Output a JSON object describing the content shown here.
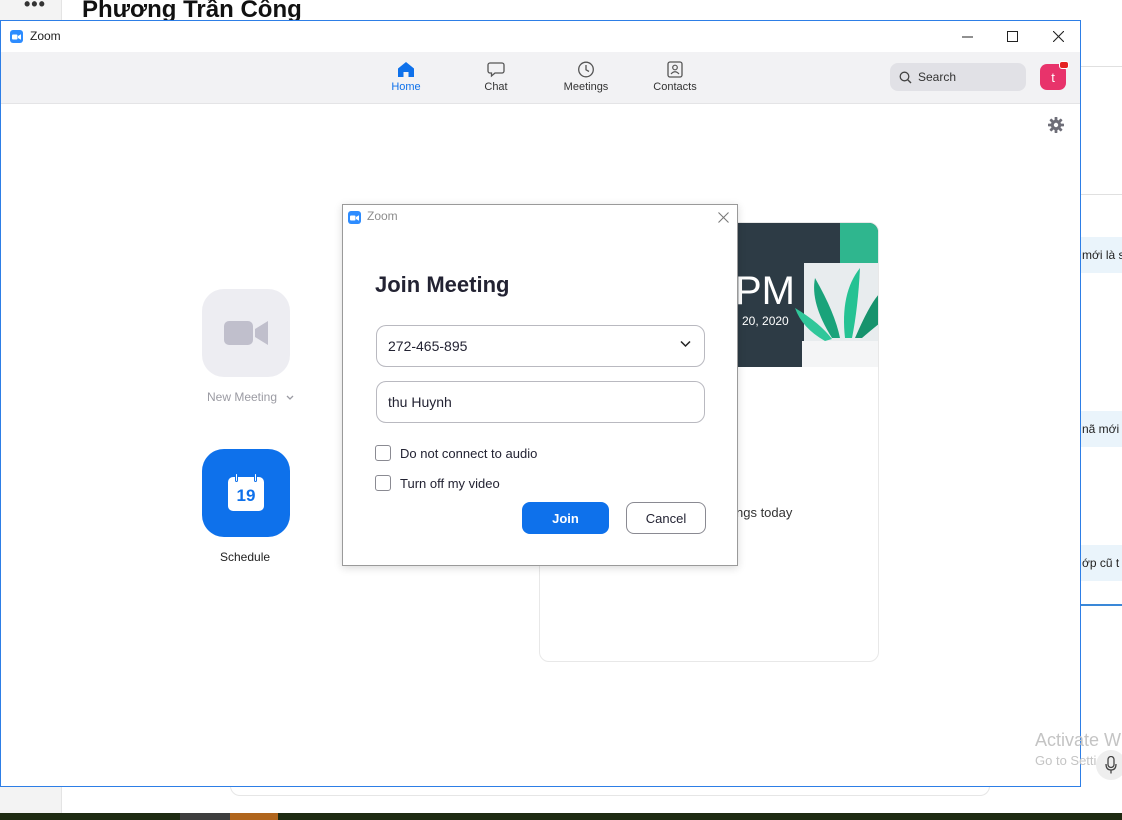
{
  "background": {
    "contact_name": "Phương Trần Công",
    "menu_dots": "•••",
    "messages": [
      "mới là s",
      "nã mới",
      "ớp cũ t"
    ]
  },
  "watermark": {
    "line1": "Activate W",
    "line2": "Go to Setti"
  },
  "window": {
    "title": "Zoom"
  },
  "nav": {
    "items": [
      {
        "label": "Home",
        "icon": "home-icon",
        "active": true
      },
      {
        "label": "Chat",
        "icon": "chat-icon",
        "active": false
      },
      {
        "label": "Meetings",
        "icon": "clock-icon",
        "active": false
      },
      {
        "label": "Contacts",
        "icon": "contacts-icon",
        "active": false
      }
    ],
    "search_label": "Search",
    "avatar_letter": "t"
  },
  "home": {
    "new_meeting_label": "New Meeting",
    "schedule_label": "Schedule",
    "schedule_day": "19"
  },
  "card": {
    "time": "PM",
    "date": "20, 2020",
    "meetings_text": "ngs today"
  },
  "dialog": {
    "title": "Zoom",
    "heading": "Join Meeting",
    "meeting_id": "272-465-895",
    "name": "thu Huynh",
    "audio_option": "Do not connect to audio",
    "video_option": "Turn off my video",
    "audio_checked": false,
    "video_checked": false,
    "join_label": "Join",
    "cancel_label": "Cancel"
  },
  "colors": {
    "accent": "#0e71eb",
    "brand_logo": "#2d8cff",
    "avatar": "#e8336b",
    "window_border": "#2d7ee6"
  }
}
